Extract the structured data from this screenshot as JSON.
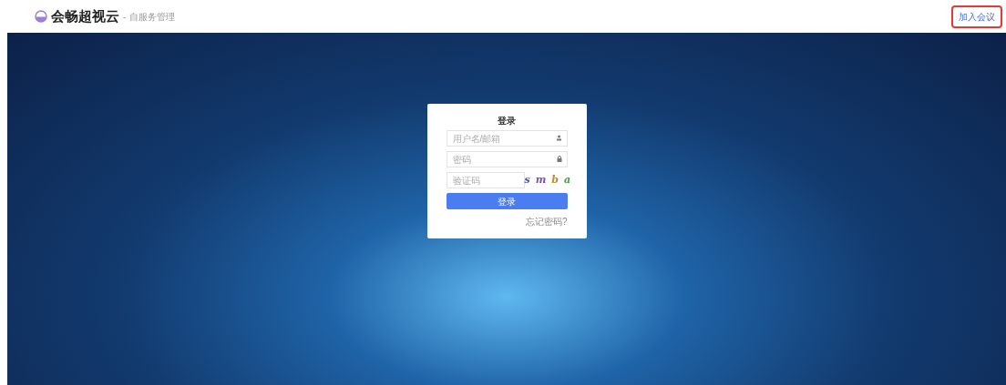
{
  "header": {
    "brand": "会畅超视云",
    "separator": "-",
    "subtitle": "自服务管理",
    "join_link": "加入会议"
  },
  "login": {
    "title": "登录",
    "username": {
      "placeholder": "用户名/邮箱"
    },
    "password": {
      "placeholder": "密码"
    },
    "captcha": {
      "placeholder": "验证码",
      "chars": [
        {
          "text": "s",
          "color": "#4a5aa8"
        },
        {
          "text": "m",
          "color": "#7b4fb0"
        },
        {
          "text": "b",
          "color": "#c08a3a"
        },
        {
          "text": "a",
          "color": "#3f9a4a"
        }
      ]
    },
    "submit": "登录",
    "forgot": "忘记密码?"
  }
}
